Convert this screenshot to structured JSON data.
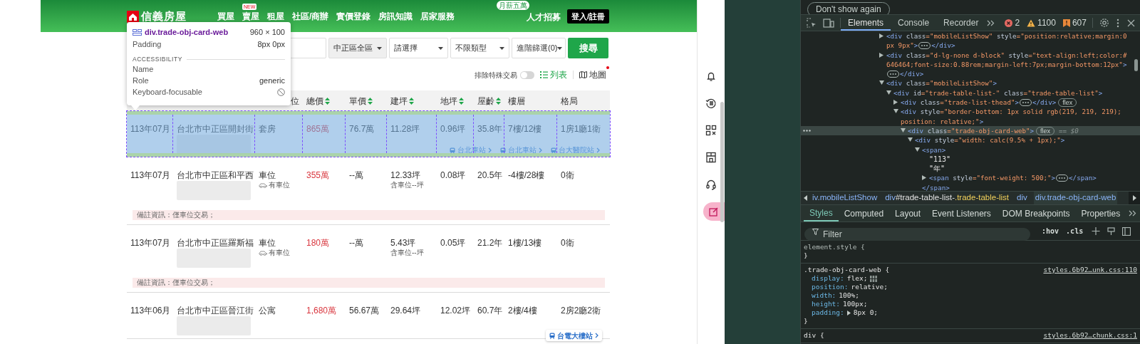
{
  "page": {
    "header": {
      "logo_text": "信義房屋",
      "nav": [
        {
          "label": "買屋"
        },
        {
          "label": "賣屋",
          "badge": "NEW"
        },
        {
          "label": "租屋"
        },
        {
          "label": "社區/商辦"
        },
        {
          "label": "實價登錄"
        },
        {
          "label": "房訊知識"
        },
        {
          "label": "居家服務"
        }
      ],
      "recruit": {
        "badge": "月薪五萬",
        "label": "人才招募"
      },
      "login_button": "登入/註冊"
    },
    "search": {
      "filters": [
        {
          "label": "中正區全區",
          "disabled": true
        },
        {
          "label": "請選擇",
          "disabled": false
        },
        {
          "label": "不限類型",
          "disabled": false
        },
        {
          "label": "進階篩選(0)",
          "disabled": false
        }
      ],
      "button": "搜尋"
    },
    "toolbar": {
      "exclude_special": {
        "label": "排除特殊交易",
        "on": false
      },
      "views": [
        {
          "label": "列表",
          "selected": true,
          "dot": false
        },
        {
          "label": "地圖",
          "selected": false,
          "dot": true
        }
      ]
    },
    "table": {
      "columns": [
        {
          "label": "位",
          "sortable": false
        },
        {
          "label": "總價",
          "sortable": true
        },
        {
          "label": "單價",
          "sortable": true
        },
        {
          "label": "建坪",
          "sortable": true
        },
        {
          "label": "地坪",
          "sortable": true
        },
        {
          "label": "屋齡",
          "sortable": true
        },
        {
          "label": "樓層",
          "sortable": false
        },
        {
          "label": "格局",
          "sortable": false
        }
      ],
      "rows": [
        {
          "date": "113年07月",
          "address": "台北市中正區開封街",
          "type": "套房",
          "total": "865萬",
          "unit": "76.7萬",
          "area": "11.28坪",
          "land": "0.96坪",
          "age": "35.8年",
          "floor": "7樓/12樓",
          "layout": "1房1廳1衛",
          "stations": [
            {
              "name": "台北車站",
              "kind": "link"
            },
            {
              "name": "台北車站",
              "kind": "link"
            },
            {
              "name": "台大醫院站",
              "kind": "link"
            }
          ],
          "highlighted": true
        },
        {
          "date": "113年07月",
          "address": "台北市中正區和平西",
          "type": "車位",
          "parking": "有車位",
          "total": "355萬",
          "unit": "--萬",
          "area": "12.33坪",
          "area_note": "含車位--坪",
          "land": "0.08坪",
          "age": "20.5年",
          "floor": "-4樓/28樓",
          "layout": "0衛",
          "remark": "備註資訊：僅車位交易；",
          "highlighted": false
        },
        {
          "date": "113年07月",
          "address": "台北市中正區羅斯福",
          "type": "車位",
          "parking": "有車位",
          "total": "180萬",
          "unit": "--萬",
          "area": "5.43坪",
          "area_note": "含車位--坪",
          "land": "0.05坪",
          "age": "21.2年",
          "floor": "1樓/13樓",
          "layout": "0衛",
          "remark": "備註資訊：僅車位交易；",
          "highlighted": false
        },
        {
          "date": "113年06月",
          "address": "台北市中正區晉江街",
          "type": "公寓",
          "total": "1,680萬",
          "unit": "56.67萬",
          "area": "29.64坪",
          "land": "12.02坪",
          "age": "60.7年",
          "floor": "2樓/4樓",
          "layout": "2房2廳2衛",
          "stations": [
            {
              "name": "台電大樓站",
              "kind": "button"
            }
          ],
          "highlighted": false
        }
      ]
    }
  },
  "inspect_tooltip": {
    "selector": "div.trade-obj-card-web",
    "size": "960 × 100",
    "padding_label": "Padding",
    "padding_value": "8px 0px",
    "section": "ACCESSIBILITY",
    "rows": [
      {
        "label": "Name"
      },
      {
        "label": "Role",
        "value": "generic"
      },
      {
        "label": "Keyboard-focusable",
        "focusable": false
      }
    ]
  },
  "devtools": {
    "banner_button": "Don't show again",
    "tabs": [
      {
        "label": "Elements",
        "selected": true
      },
      {
        "label": "Console",
        "selected": false
      },
      {
        "label": "Recorder",
        "selected": false
      }
    ],
    "errors": "2",
    "warnings": "1100",
    "issues": "607",
    "dom": [
      {
        "expanded": false,
        "selected": false,
        "parts": [
          {
            "kind": "tag",
            "text": "<div"
          },
          {
            "kind": "attr",
            "text": " class"
          },
          {
            "kind": "value",
            "text": "=\"mobileListShow\""
          },
          {
            "kind": "attr",
            "text": " style"
          },
          {
            "kind": "value",
            "text": "=\"position:relative;margin:0"
          },
          {
            "kind": "break"
          },
          {
            "kind": "value",
            "text": "px 9px\""
          },
          {
            "kind": "tag",
            "text": ">"
          },
          {
            "kind": "more"
          },
          {
            "kind": "tag",
            "text": "</div>"
          }
        ]
      },
      {
        "expanded": false,
        "selected": false,
        "parts": [
          {
            "kind": "tag",
            "text": "<div"
          },
          {
            "kind": "attr",
            "text": " class"
          },
          {
            "kind": "value",
            "text": "=\"d-lg-none d-block\""
          },
          {
            "kind": "attr",
            "text": " style"
          },
          {
            "kind": "value",
            "text": "=\"text-align:left;color:#"
          },
          {
            "kind": "break"
          },
          {
            "kind": "value",
            "text": "646464;font-size:0.88rem;margin-left:7px;margin-bottom:12px\""
          },
          {
            "kind": "tag",
            "text": ">"
          },
          {
            "kind": "break"
          },
          {
            "kind": "more"
          },
          {
            "kind": "tag",
            "text": "</div>"
          }
        ]
      },
      {
        "expanded": true,
        "selected": false,
        "parts": [
          {
            "kind": "tag",
            "text": "<div"
          },
          {
            "kind": "attr",
            "text": " class"
          },
          {
            "kind": "value",
            "text": "=\"mobileListShow\""
          },
          {
            "kind": "tag",
            "text": ">"
          }
        ],
        "children": [
          {
            "expanded": true,
            "selected": false,
            "parts": [
              {
                "kind": "tag",
                "text": "<div"
              },
              {
                "kind": "attr",
                "text": " id"
              },
              {
                "kind": "value",
                "text": "=\"trade-table-list-\""
              },
              {
                "kind": "attr",
                "text": " class"
              },
              {
                "kind": "value",
                "text": "=\"trade-table-list\""
              },
              {
                "kind": "tag",
                "text": ">"
              }
            ],
            "children": [
              {
                "expanded": false,
                "selected": false,
                "parts": [
                  {
                    "kind": "tag",
                    "text": "<div"
                  },
                  {
                    "kind": "attr",
                    "text": " class"
                  },
                  {
                    "kind": "value",
                    "text": "=\"trade-list-thead\""
                  },
                  {
                    "kind": "tag",
                    "text": ">"
                  },
                  {
                    "kind": "more"
                  },
                  {
                    "kind": "tag",
                    "text": "</div>"
                  },
                  {
                    "kind": "badge",
                    "text": "flex"
                  }
                ]
              },
              {
                "expanded": true,
                "selected": false,
                "parts": [
                  {
                    "kind": "tag",
                    "text": "<div"
                  },
                  {
                    "kind": "attr",
                    "text": " style"
                  },
                  {
                    "kind": "value",
                    "text": "=\"border-bottom: 1px solid rgb(219, 219, 219);"
                  },
                  {
                    "kind": "break"
                  },
                  {
                    "kind": "value",
                    "text": "position: relative;\""
                  },
                  {
                    "kind": "tag",
                    "text": ">"
                  }
                ],
                "children": [
                  {
                    "expanded": true,
                    "selected": true,
                    "parts": [
                      {
                        "kind": "tag",
                        "text": "<div"
                      },
                      {
                        "kind": "attr",
                        "text": " class"
                      },
                      {
                        "kind": "value",
                        "text": "=\"trade-obj-card-web\""
                      },
                      {
                        "kind": "tag",
                        "text": ">"
                      },
                      {
                        "kind": "badge",
                        "text": "flex"
                      },
                      {
                        "kind": "marker",
                        "text": "== $0"
                      }
                    ],
                    "children": [
                      {
                        "expanded": true,
                        "selected": false,
                        "parts": [
                          {
                            "kind": "tag",
                            "text": "<div"
                          },
                          {
                            "kind": "attr",
                            "text": " style"
                          },
                          {
                            "kind": "value",
                            "text": "=\"width: calc(9.5% + 1px);\""
                          },
                          {
                            "kind": "tag",
                            "text": ">"
                          }
                        ],
                        "children": [
                          {
                            "expanded": true,
                            "selected": false,
                            "parts": [
                              {
                                "kind": "tag",
                                "text": "<span>"
                              }
                            ],
                            "closing": "</span>",
                            "children": [
                              {
                                "selected": false,
                                "parts": [
                                  {
                                    "kind": "text",
                                    "text": "\"113\""
                                  }
                                ]
                              },
                              {
                                "selected": false,
                                "parts": [
                                  {
                                    "kind": "text",
                                    "text": "\"年\""
                                  }
                                ]
                              },
                              {
                                "expanded": false,
                                "selected": false,
                                "parts": [
                                  {
                                    "kind": "tag",
                                    "text": "<span"
                                  },
                                  {
                                    "kind": "attr",
                                    "text": " style"
                                  },
                                  {
                                    "kind": "value",
                                    "text": "=\"font-weight: 500;\""
                                  },
                                  {
                                    "kind": "tag",
                                    "text": ">"
                                  },
                                  {
                                    "kind": "more"
                                  },
                                  {
                                    "kind": "tag",
                                    "text": "</span>"
                                  }
                                ]
                              }
                            ]
                          }
                        ]
                      }
                    ]
                  }
                ]
              }
            ]
          }
        ]
      }
    ],
    "breadcrumbs": [
      {
        "selected": false,
        "parts": [
          {
            "kind": "tag",
            "text": "iv.mobileListShow"
          }
        ]
      },
      {
        "selected": false,
        "parts": [
          {
            "kind": "tag",
            "text": "div"
          },
          {
            "kind": "id",
            "text": "#trade-table-list-"
          },
          {
            "kind": "cls",
            "text": ".trade-table-list"
          }
        ]
      },
      {
        "selected": false,
        "parts": [
          {
            "kind": "tag",
            "text": "div"
          }
        ]
      },
      {
        "selected": true,
        "parts": [
          {
            "kind": "tag",
            "text": "div.trade-obj-card-web"
          }
        ]
      }
    ],
    "style_tabs": [
      {
        "label": "Styles",
        "selected": true
      },
      {
        "label": "Computed",
        "selected": false
      },
      {
        "label": "Layout",
        "selected": false
      },
      {
        "label": "Event Listeners",
        "selected": false
      },
      {
        "label": "DOM Breakpoints",
        "selected": false
      },
      {
        "label": "Properties",
        "selected": false
      }
    ],
    "filter": {
      "placeholder": "Filter"
    },
    "hov": ":hov",
    "cls": ".cls",
    "rules": [
      {
        "kind": "inline",
        "header": "element.style {",
        "close": "}"
      },
      {
        "kind": "rule",
        "header": ".trade-obj-card-web {",
        "source": "styles.6b92…unk.css:110",
        "close": "}",
        "props": [
          {
            "name": "display:",
            "value": "flex;",
            "editor": true,
            "expandable": false
          },
          {
            "name": "position:",
            "value": "relative;",
            "editor": false,
            "expandable": false
          },
          {
            "name": "width:",
            "value": "100%;",
            "editor": false,
            "expandable": false
          },
          {
            "name": "height:",
            "value": "100px;",
            "editor": false,
            "expandable": false
          },
          {
            "name": "padding:",
            "value": "8px 0;",
            "editor": false,
            "expandable": true
          }
        ]
      },
      {
        "kind": "rule",
        "header": "div {",
        "source": "styles.6b92…chunk.css:1"
      }
    ]
  }
}
